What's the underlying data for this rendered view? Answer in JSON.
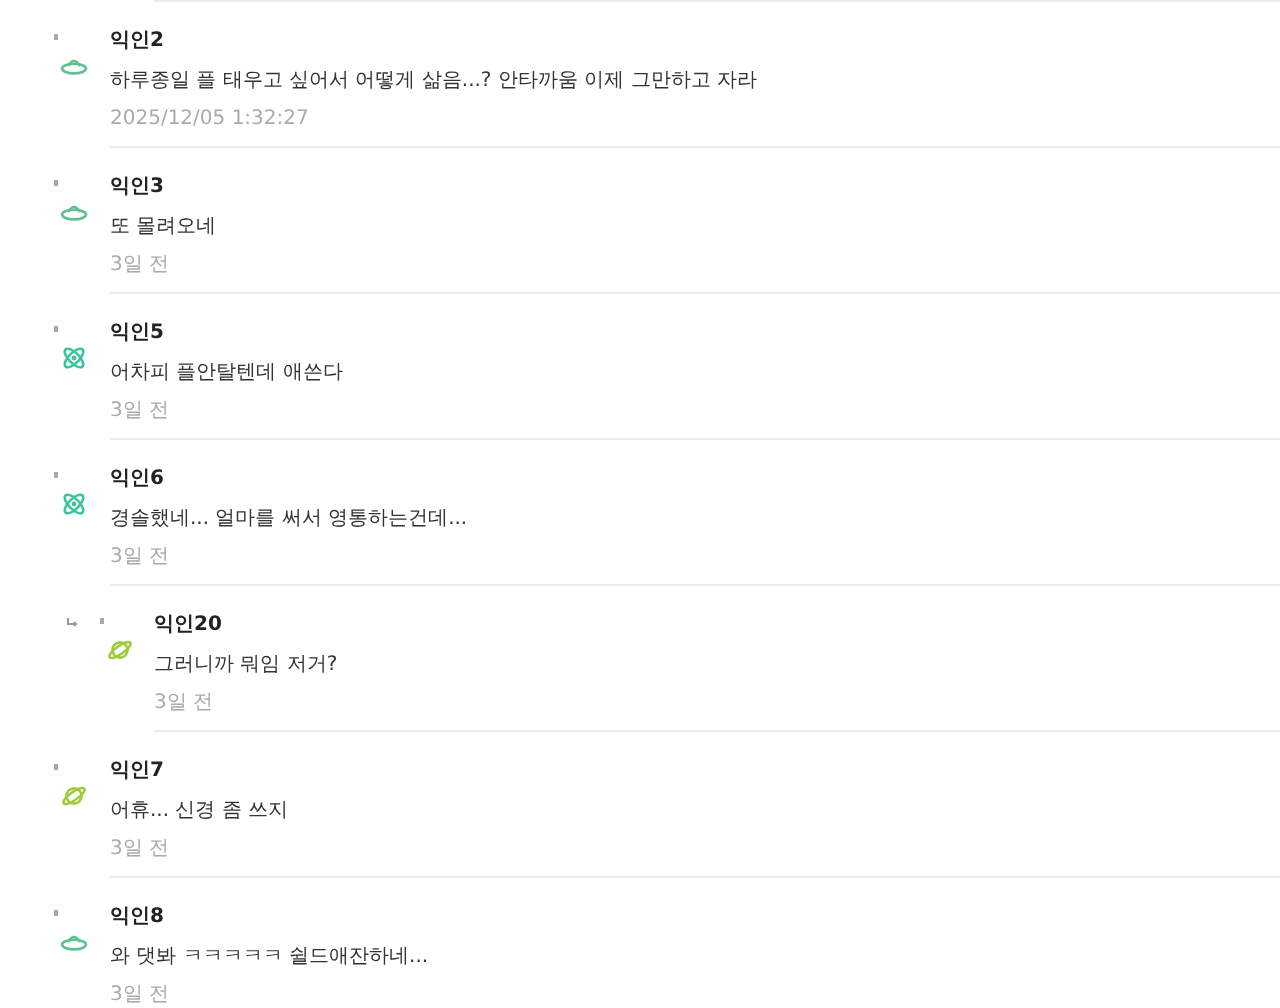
{
  "comments": [
    {
      "author": "익인2",
      "kind": "ufo",
      "reply": false,
      "text": "하루종일 플 태우고 싶어서 어떻게 삶음...? 안타까움 이제 그만하고 자라",
      "time": "2025/12/05 1:32:27"
    },
    {
      "author": "익인3",
      "kind": "ufo",
      "reply": false,
      "text": "또 몰려오네",
      "time": "3일 전"
    },
    {
      "author": "익인5",
      "kind": "atom",
      "reply": false,
      "text": "어차피 플안탈텐데 애쓴다",
      "time": "3일 전"
    },
    {
      "author": "익인6",
      "kind": "atom",
      "reply": false,
      "text": "경솔했네... 얼마를 써서 영통하는건데...",
      "time": "3일 전"
    },
    {
      "author": "익인20",
      "kind": "planet",
      "reply": true,
      "text": "그러니까 뭐임 저거?",
      "time": "3일 전"
    },
    {
      "author": "익인7",
      "kind": "planet",
      "reply": false,
      "text": "어휴... 신경 좀 쓰지",
      "time": "3일 전"
    },
    {
      "author": "익인8",
      "kind": "ufo",
      "reply": false,
      "text": "와 댓봐 ㅋㅋㅋㅋㅋ 쉴드애잔하네...",
      "time": "3일 전"
    }
  ]
}
